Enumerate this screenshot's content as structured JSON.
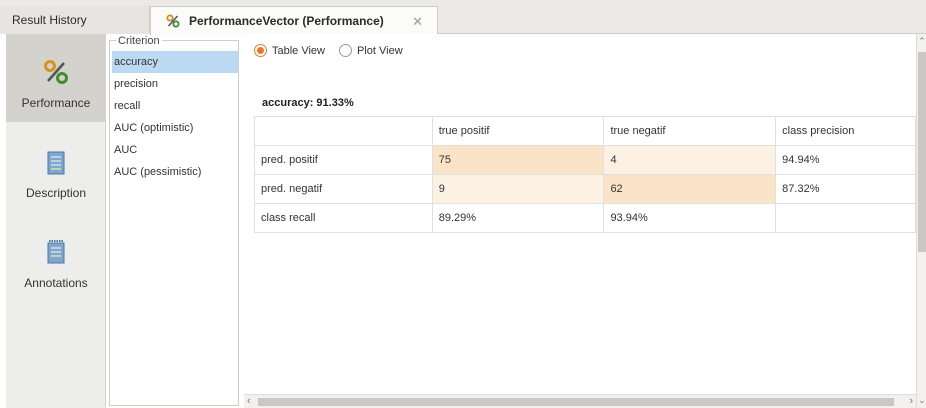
{
  "tabs": {
    "result_history": "Result History",
    "performance": "PerformanceVector (Performance)",
    "close": "✕"
  },
  "nav": [
    {
      "label": "Performance",
      "icon": "percent-icon",
      "active": true
    },
    {
      "label": "Description",
      "icon": "document-icon",
      "active": false
    },
    {
      "label": "Annotations",
      "icon": "notes-icon",
      "active": false
    }
  ],
  "criterion": {
    "legend": "Criterion",
    "items": [
      "accuracy",
      "precision",
      "recall",
      "AUC (optimistic)",
      "AUC",
      "AUC (pessimistic)"
    ],
    "selected": "accuracy"
  },
  "views": {
    "table": "Table View",
    "plot": "Plot View",
    "selected": "Table View"
  },
  "accuracy_label": "accuracy: 91.33%",
  "matrix": {
    "header": [
      "",
      "true positif",
      "true negatif",
      "class precision"
    ],
    "rows": [
      [
        "pred. positif",
        "75",
        "4",
        "94.94%"
      ],
      [
        "pred. negatif",
        "9",
        "62",
        "87.32%"
      ],
      [
        "class recall",
        "89.29%",
        "93.94%",
        ""
      ]
    ]
  },
  "colors": {
    "diag": "#fbe3c8",
    "offdiag": "#fdf1e4",
    "selected": "#bcd9f4",
    "accent": "#e8782a"
  }
}
